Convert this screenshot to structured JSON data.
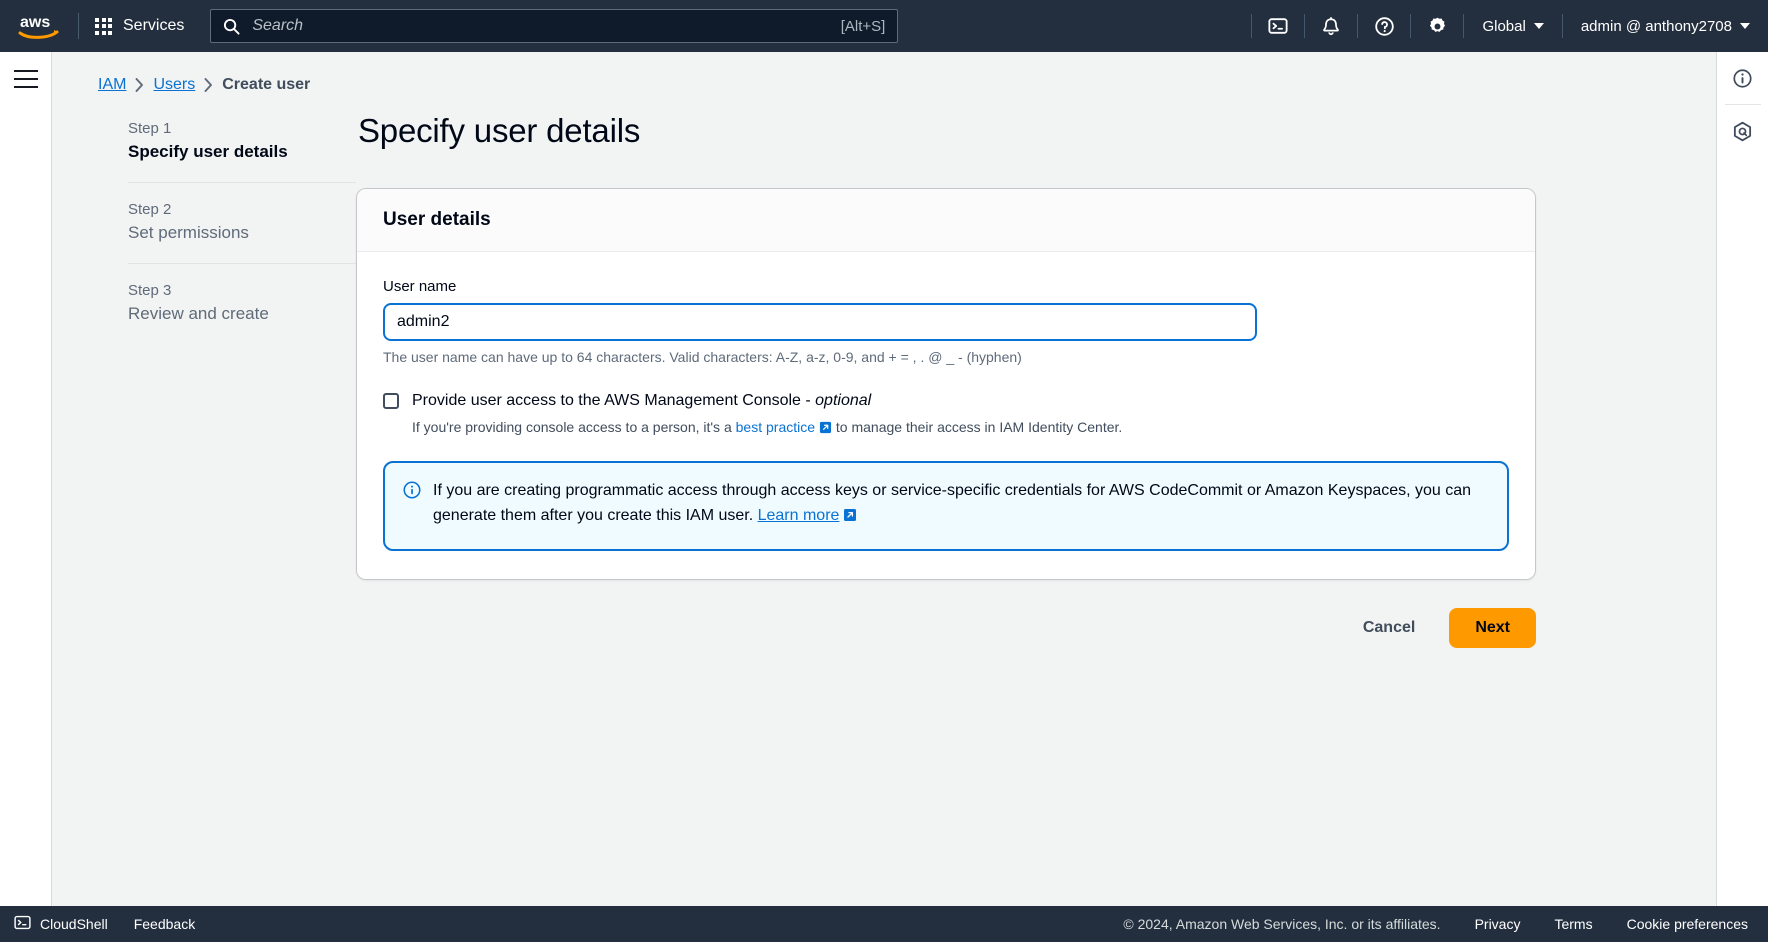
{
  "topnav": {
    "logo_alt": "aws",
    "services_label": "Services",
    "search_placeholder": "Search",
    "search_value": "",
    "search_shortcut": "[Alt+S]",
    "icons": [
      "cloudshell-icon",
      "bell-icon",
      "help-icon",
      "settings-icon"
    ],
    "region_label": "Global",
    "account_label": "admin @ anthony2708"
  },
  "breadcrumb": {
    "items": [
      {
        "label": "IAM",
        "link": true
      },
      {
        "label": "Users",
        "link": true
      },
      {
        "label": "Create user",
        "link": false
      }
    ],
    "separator": "›"
  },
  "steps": [
    {
      "num": "Step 1",
      "title": "Specify user details",
      "active": true
    },
    {
      "num": "Step 2",
      "title": "Set permissions",
      "active": false
    },
    {
      "num": "Step 3",
      "title": "Review and create",
      "active": false
    }
  ],
  "main": {
    "page_title": "Specify user details",
    "card_title": "User details",
    "username_label": "User name",
    "username_value": "admin2",
    "username_placeholder": "",
    "username_help": "The user name can have up to 64 characters. Valid characters: A-Z, a-z, 0-9, and + = , . @ _ - (hyphen)",
    "console_checkbox_checked": false,
    "console_checkbox_label": "Provide user access to the AWS Management Console - ",
    "console_checkbox_label_optional": "optional",
    "console_sub_pre": "If you're providing console access to a person, it's a ",
    "console_sub_link": "best practice",
    "console_sub_post": " to manage their access in IAM Identity Center.",
    "alert_text_pre": "If you are creating programmatic access through access keys or service-specific credentials for AWS CodeCommit or Amazon Keyspaces, you can generate them after you create this IAM user. ",
    "alert_link": "Learn more",
    "cancel_label": "Cancel",
    "next_label": "Next"
  },
  "rightrail": {
    "icons": [
      "info-panel-icon",
      "aws-q-icon"
    ]
  },
  "footer": {
    "cloudshell_label": "CloudShell",
    "feedback_label": "Feedback",
    "copyright": "© 2024, Amazon Web Services, Inc. or its affiliates.",
    "privacy_label": "Privacy",
    "terms_label": "Terms",
    "cookie_label": "Cookie preferences"
  },
  "colors": {
    "nav_bg": "#232f3e",
    "accent_blue": "#0972d3",
    "primary_orange": "#ff9900",
    "page_bg": "#f2f3f3"
  }
}
